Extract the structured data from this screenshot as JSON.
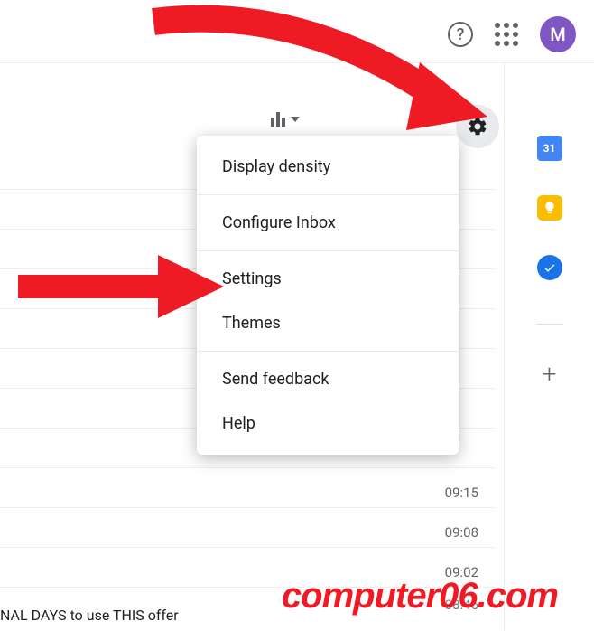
{
  "header": {
    "avatar_letter": "M"
  },
  "menu": {
    "items": [
      "Display density",
      "Configure Inbox",
      "Settings",
      "Themes",
      "Send feedback",
      "Help"
    ]
  },
  "sidebar": {
    "calendar_day": "31"
  },
  "mail": {
    "times": [
      "09:15",
      "09:08",
      "09:02",
      "08:46"
    ],
    "footer_snippet": "NAL DAYS to use THIS offer"
  },
  "watermark": "computer06.com"
}
